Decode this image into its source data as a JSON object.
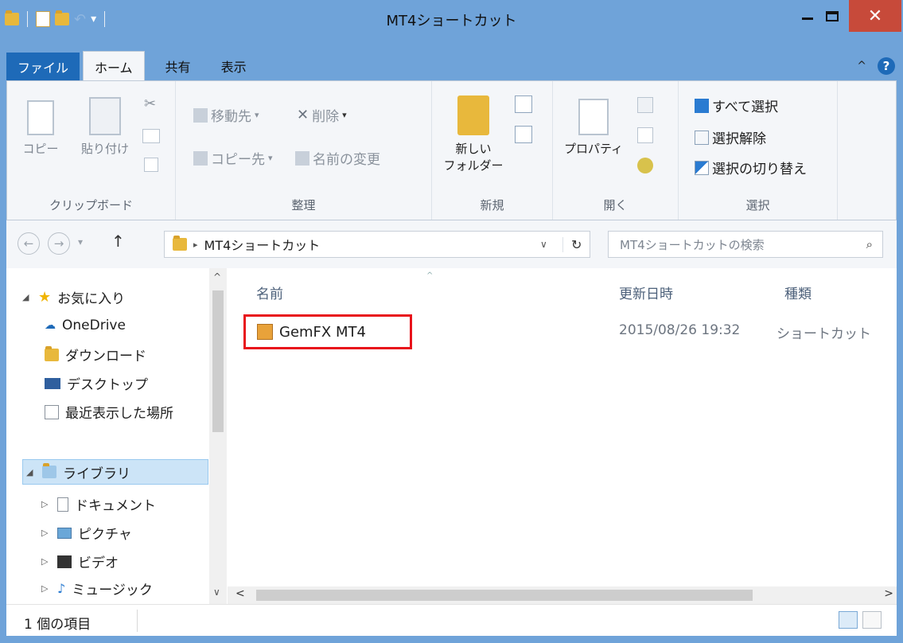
{
  "window": {
    "title": "MT4ショートカット"
  },
  "tabs": {
    "file": "ファイル",
    "home": "ホーム",
    "share": "共有",
    "view": "表示"
  },
  "ribbon": {
    "clipboard": {
      "label": "クリップボード",
      "copy": "コピー",
      "paste": "貼り付け"
    },
    "organize": {
      "label": "整理",
      "move_to": "移動先",
      "delete": "削除",
      "copy_to": "コピー先",
      "rename": "名前の変更"
    },
    "new": {
      "label": "新規",
      "new_folder_line1": "新しい",
      "new_folder_line2": "フォルダー"
    },
    "open": {
      "label": "開く",
      "properties": "プロパティ"
    },
    "select": {
      "label": "選択",
      "select_all": "すべて選択",
      "select_none": "選択解除",
      "invert": "選択の切り替え"
    }
  },
  "address": {
    "path": "MT4ショートカット",
    "search_placeholder": "MT4ショートカットの検索"
  },
  "navpane": {
    "favorites": "お気に入り",
    "onedrive": "OneDrive",
    "downloads": "ダウンロード",
    "desktop": "デスクトップ",
    "recent": "最近表示した場所",
    "libraries": "ライブラリ",
    "documents": "ドキュメント",
    "pictures": "ピクチャ",
    "videos": "ビデオ",
    "music": "ミュージック"
  },
  "filelist": {
    "headers": {
      "name": "名前",
      "date": "更新日時",
      "type": "種類"
    },
    "files": [
      {
        "name": "GemFX MT4",
        "date": "2015/08/26 19:32",
        "type": "ショートカット"
      }
    ]
  },
  "status": {
    "count": "1 個の項目"
  },
  "colors": {
    "titlebar": "#6fa3d9",
    "file_tab": "#1e6ab8",
    "close_button": "#c74a3a",
    "highlight_box": "#e8131b"
  }
}
